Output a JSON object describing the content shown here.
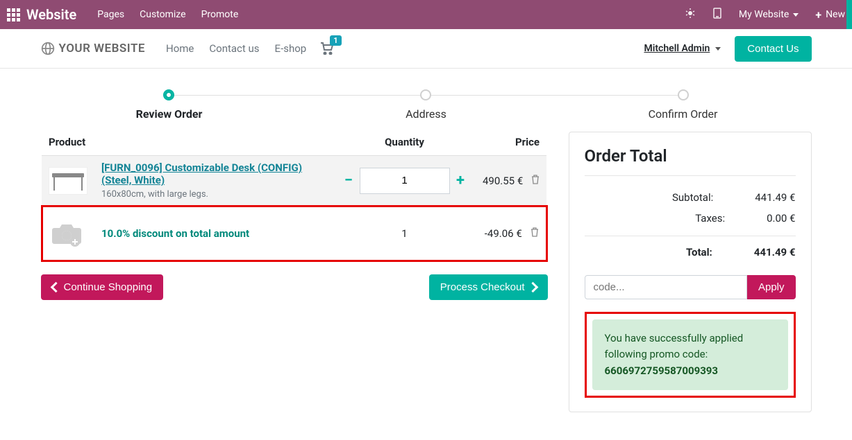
{
  "topbar": {
    "brand": "Website",
    "nav": [
      "Pages",
      "Customize",
      "Promote"
    ],
    "site_dropdown": "My Website",
    "new_label": "New"
  },
  "subnav": {
    "logo_text": "YOUR WEBSITE",
    "nav": [
      "Home",
      "Contact us",
      "E-shop"
    ],
    "cart_count": "1",
    "user": "Mitchell Admin",
    "contact_btn": "Contact Us"
  },
  "wizard": {
    "steps": [
      "Review Order",
      "Address",
      "Confirm Order"
    ]
  },
  "cart": {
    "headers": {
      "product": "Product",
      "quantity": "Quantity",
      "price": "Price"
    },
    "items": [
      {
        "name": "[FURN_0096] Customizable Desk (CONFIG) (Steel, White)",
        "sub": "160x80cm, with large legs.",
        "qty": "1",
        "price": "490.55 €"
      },
      {
        "name": "10.0% discount on total amount",
        "qty": "1",
        "price": "-49.06 €"
      }
    ]
  },
  "actions": {
    "continue": "Continue Shopping",
    "checkout": "Process Checkout"
  },
  "summary": {
    "title": "Order Total",
    "subtotal_label": "Subtotal:",
    "subtotal": "441.49 €",
    "taxes_label": "Taxes:",
    "taxes": "0.00 €",
    "total_label": "Total:",
    "total": "441.49 €",
    "code_placeholder": "code...",
    "apply": "Apply",
    "promo_msg": "You have successfully applied following promo code:",
    "promo_code": "6606972759587009393"
  }
}
